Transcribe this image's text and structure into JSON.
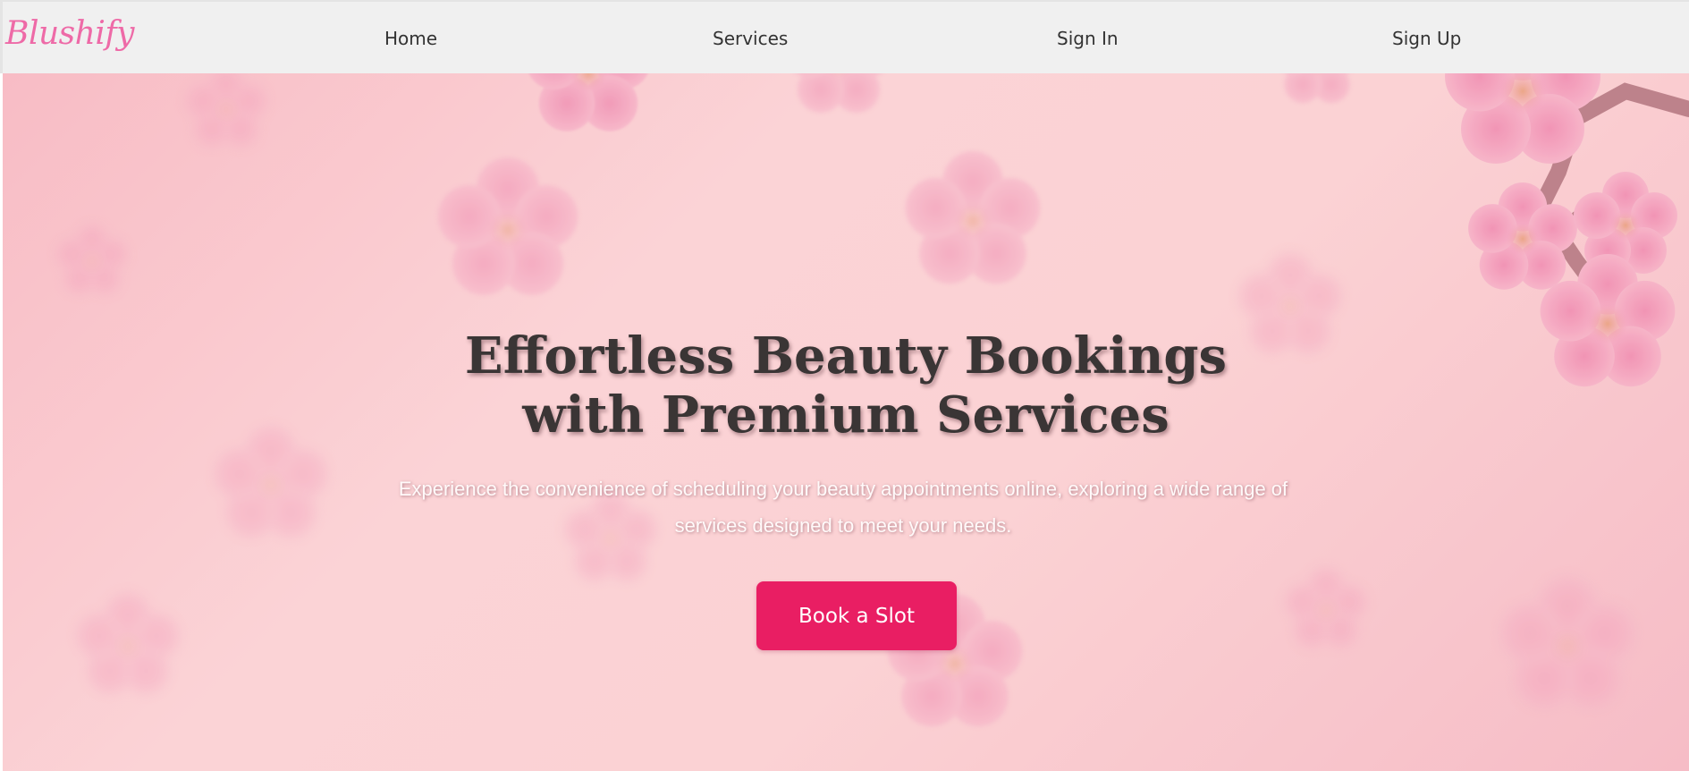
{
  "nav": {
    "logo": "Blushify",
    "links": [
      {
        "label": "Home"
      },
      {
        "label": "Services"
      },
      {
        "label": "Sign In"
      },
      {
        "label": "Sign Up"
      }
    ]
  },
  "hero": {
    "title": "Effortless Beauty Bookings with Premium Services",
    "subtitle": "Experience the convenience of scheduling your beauty appointments online, exploring a wide range of services designed to meet your needs.",
    "cta_label": "Book a Slot",
    "background_image": "cherry-blossom-background"
  },
  "colors": {
    "nav_background": "#f0f0f0",
    "logo": "#ee6aa7",
    "hero_background": "#fbd3d6",
    "blossom": "#f29ab8",
    "cta_background": "#e91e63",
    "cta_text": "#ffffff",
    "title_text": "#3a3535",
    "subtitle_text": "#fffafa"
  }
}
